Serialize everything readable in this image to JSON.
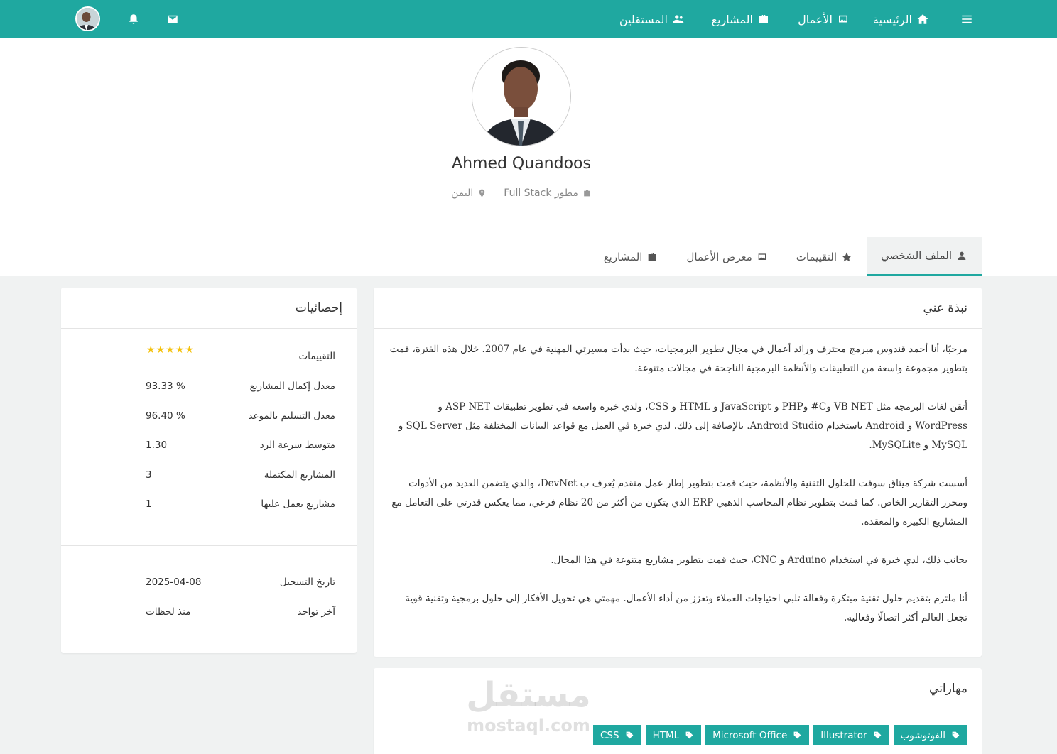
{
  "nav": {
    "home": "الرئيسية",
    "portfolio": "الأعمال",
    "projects": "المشاريع",
    "freelancers": "المستقلين"
  },
  "profile": {
    "name": "Ahmed Quandoos",
    "job": "مطور Full Stack",
    "location": "اليمن"
  },
  "tabs": {
    "profile": "الملف الشخصي",
    "reviews": "التقييمات",
    "portfolio": "معرض الأعمال",
    "projects": "المشاريع"
  },
  "about": {
    "title": "نبذة عني",
    "paragraphs": [
      "مرحبًا، أنا أحمد قندوس مبرمج محترف ورائد أعمال في مجال تطوير البرمجيات، حيث بدأت مسيرتي المهنية في عام 2007. خلال هذه الفترة، قمت بتطوير مجموعة واسعة من التطبيقات والأنظمة البرمجية الناجحة في مجالات متنوعة.",
      "أتقن لغات البرمجة مثل VB NET وC# وPHP و JavaScript و HTML و CSS، ولدي خبرة واسعة في تطوير تطبيقات ASP NET و WordPress و Android باستخدام Android Studio. بالإضافة إلى ذلك، لدي خبرة في العمل مع قواعد البيانات المختلفة مثل SQL Server و MySQL و MySQLite.",
      "أسست شركة ميثاق سوفت للحلول التقنية والأنظمة، حيث قمت بتطوير إطار عمل متقدم يُعرف ب DevNet، والذي يتضمن العديد من الأدوات ومحرر التقارير الخاص. كما قمت بتطوير نظام المحاسب الذهبي ERP الذي يتكون من أكثر من 20 نظام فرعي، مما يعكس قدرتي على التعامل مع المشاريع الكبيرة والمعقدة.",
      "بجانب ذلك، لدي خبرة في استخدام Arduino و CNC، حيث قمت بتطوير مشاريع متنوعة في هذا المجال.",
      "أنا ملتزم بتقديم حلول تقنية مبتكرة وفعالة تلبي احتياجات العملاء وتعزز من أداء الأعمال. مهمتي هي تحويل الأفكار إلى حلول برمجية وتقنية قوية تجعل العالم أكثر اتصالًا وفعالية."
    ]
  },
  "stats": {
    "title": "إحصائيات",
    "rating_label": "التقييمات",
    "rating_value": 5,
    "rows": [
      {
        "label": "معدل إكمال المشاريع",
        "value": "93.33 %"
      },
      {
        "label": "معدل التسليم بالموعد",
        "value": "96.40 %"
      },
      {
        "label": "متوسط سرعة الرد",
        "value": "1.30"
      },
      {
        "label": "المشاريع المكتملة",
        "value": "3"
      },
      {
        "label": "مشاريع يعمل عليها",
        "value": "1"
      }
    ],
    "registered_label": "تاريخ التسجيل",
    "registered_value": "2025-04-08",
    "last_seen_label": "آخر تواجد",
    "last_seen_value": "منذ لحظات"
  },
  "skills": {
    "title": "مهاراتي",
    "items": [
      "الفوتوشوب",
      "Illustrator",
      "Microsoft Office",
      "HTML",
      "CSS"
    ]
  },
  "watermark": {
    "ar": "مستقل",
    "en": "mostaql.com"
  },
  "colors": {
    "brand": "#1fa8a0",
    "star": "#f4c20d"
  }
}
